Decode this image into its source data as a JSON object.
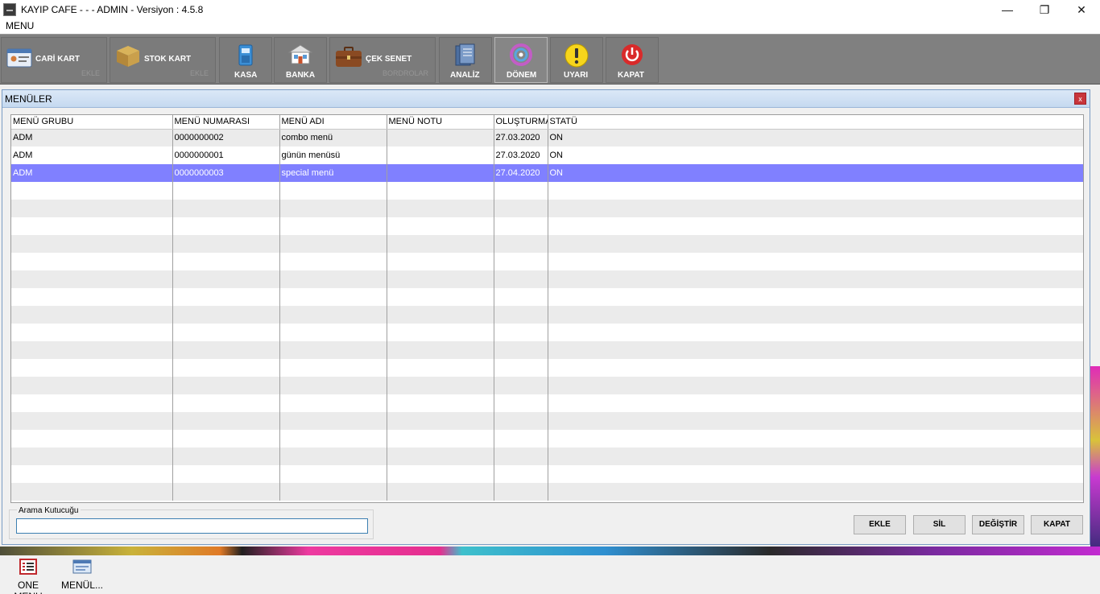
{
  "titlebar": {
    "title": "KAYIP CAFE -  -  - ADMIN -  Versiyon : 4.5.8",
    "minimize": "—",
    "maximize": "❐",
    "close": "✕"
  },
  "menubar": {
    "menu": "MENU"
  },
  "toolbar": {
    "cari_kart": {
      "label": "CARİ KART",
      "sub": "EKLE"
    },
    "stok_kart": {
      "label": "STOK KART",
      "sub": "EKLE"
    },
    "kasa": {
      "label": "KASA"
    },
    "banka": {
      "label": "BANKA"
    },
    "cek_senet": {
      "label": "ÇEK SENET",
      "sub": "BORDROLAR"
    },
    "analiz": {
      "label": "ANALİZ"
    },
    "donem": {
      "label": "DÖNEM"
    },
    "uyari": {
      "label": "UYARI"
    },
    "kapat": {
      "label": "KAPAT"
    }
  },
  "window": {
    "title": "MENÜLER",
    "close": "x",
    "columns": [
      "MENÜ GRUBU",
      "MENÜ NUMARASI",
      "MENÜ ADI",
      "MENÜ NOTU",
      "OLUŞTURMA",
      "STATÜ"
    ],
    "rows": [
      [
        "ADM",
        "0000000002",
        "combo menü",
        "",
        "27.03.2020",
        "ON"
      ],
      [
        "ADM",
        "0000000001",
        "günün menüsü",
        "",
        "27.03.2020",
        "ON"
      ],
      [
        "ADM",
        "0000000003",
        "special menü",
        "",
        "27.04.2020",
        "ON"
      ]
    ],
    "selected_row": 2,
    "search": {
      "label": "Arama Kutucuğu",
      "value": ""
    },
    "buttons": {
      "ekle": "EKLE",
      "sil": "SİL",
      "degistir": "DEĞİŞTİR",
      "kapat": "KAPAT"
    }
  },
  "taskbar": {
    "one_menu": "ONE MENU",
    "menuler": "MENÜL..."
  },
  "colors": {
    "toolbar_bg": "#808080",
    "selection": "#8080ff",
    "window_border": "#7a9cc4"
  }
}
